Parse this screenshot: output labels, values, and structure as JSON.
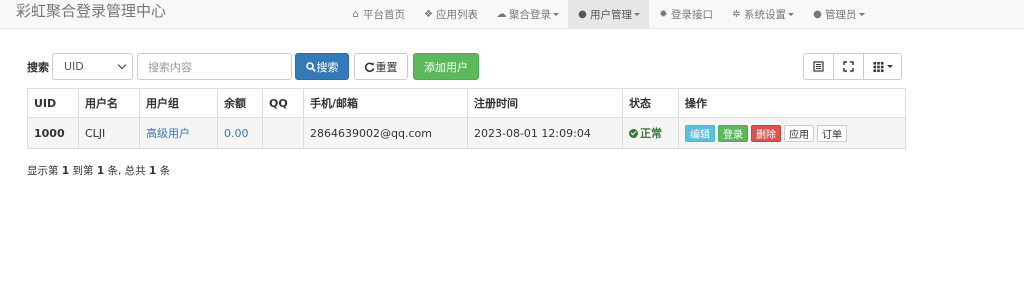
{
  "brand": "彩虹聚合登录管理中心",
  "nav": [
    {
      "icon": "home-icon",
      "glyph": "⌂",
      "label": "平台首页"
    },
    {
      "icon": "cubes-icon",
      "glyph": "❖",
      "label": "应用列表"
    },
    {
      "icon": "cloud-icon",
      "glyph": "☁",
      "label": "聚合登录"
    },
    {
      "icon": "user-icon",
      "glyph": "●",
      "label": "用户管理"
    },
    {
      "icon": "gear-icon",
      "glyph": "✹",
      "label": "登录接口"
    },
    {
      "icon": "cog-icon",
      "glyph": "✲",
      "label": "系统设置"
    },
    {
      "icon": "person-icon",
      "glyph": "●",
      "label": "管理员"
    }
  ],
  "search": {
    "label": "搜索",
    "field": "UID",
    "placeholder": "搜索内容",
    "search_btn": "搜索",
    "reset_btn": "重置",
    "add_btn": "添加用户"
  },
  "table": {
    "headers": [
      "UID",
      "用户名",
      "用户组",
      "余额",
      "QQ",
      "手机/邮箱",
      "注册时间",
      "状态",
      "操作"
    ],
    "row": {
      "uid": "1000",
      "username": "CLJI",
      "group": "高级用户",
      "balance": "0.00",
      "qq": "",
      "contact": "2864639002@qq.com",
      "reg_time": "2023-08-01 12:09:04",
      "status": "正常",
      "actions": [
        "编辑",
        "登录",
        "删除",
        "应用",
        "订单"
      ]
    }
  },
  "pagination": {
    "p1": "显示第",
    "from": "1",
    "p2": "到第",
    "to": "1",
    "p3": "条, 总共",
    "total": "1",
    "p4": "条"
  },
  "colors": {
    "primary": "#337ab7",
    "success": "#5cb85c",
    "danger": "#d9534f",
    "info": "#5bc0de"
  }
}
